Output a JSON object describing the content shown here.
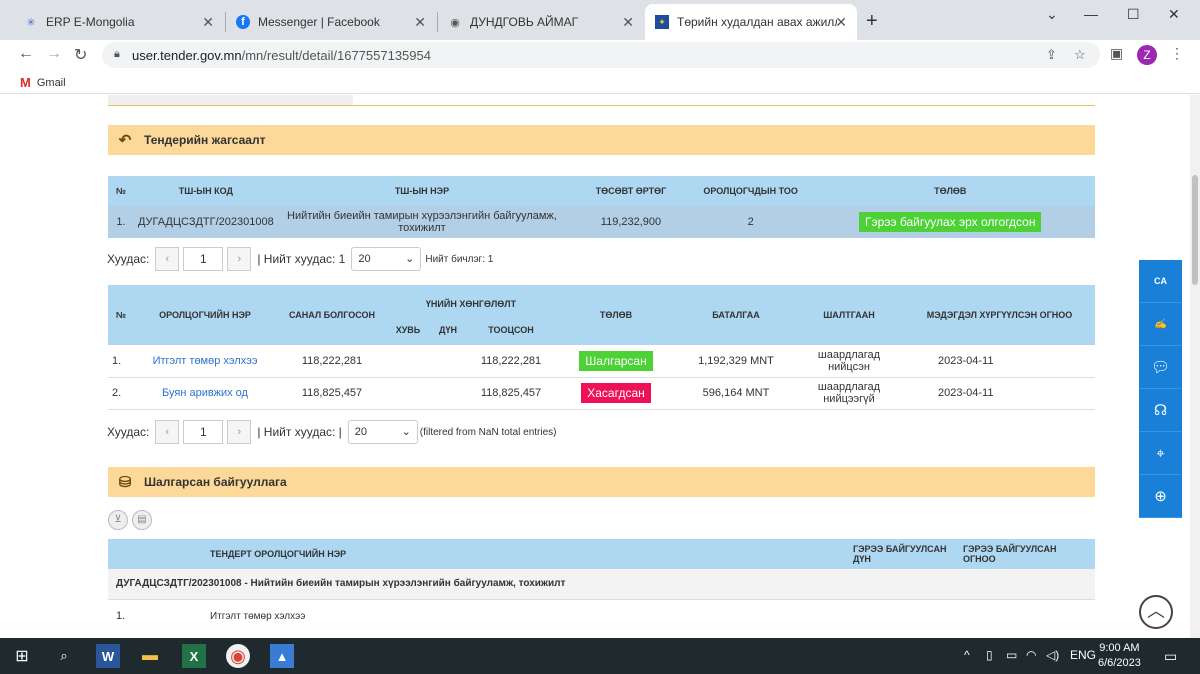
{
  "browser": {
    "tabs": [
      {
        "label": "ERP E-Mongolia",
        "icon": "erp-icon"
      },
      {
        "label": "Messenger | Facebook",
        "icon": "facebook-icon"
      },
      {
        "label": "ДУНДГОВЬ АЙМАГ",
        "icon": "globe-icon"
      },
      {
        "label": "Төрийн худалдан авах ажиллага",
        "icon": "emblem-icon"
      }
    ],
    "url_host": "user.tender.gov.mn",
    "url_path": "/mn/result/detail/1677557135954",
    "profile_initial": "Z",
    "bookmark": "Gmail"
  },
  "section1": {
    "title": "Тендерийн жагсаалт",
    "headers": [
      "№",
      "ТШ-ЫН КОД",
      "ТШ-ЫН НЭР",
      "ТӨСӨВТ ӨРТӨГ",
      "ОРОЛЦОГЧДЫН ТОО",
      "ТӨЛӨВ"
    ],
    "rows": [
      {
        "no": "1.",
        "code": "ДУГАДЦСЗДТГ/202301008",
        "name": "Нийтийн биеийн тамирын хүрээлэнгийн байгууламж, тохижилт",
        "budget": "119,232,900",
        "count": "2",
        "status": "Гэрээ байгуулах эрх олгогдсон"
      }
    ]
  },
  "pager1": {
    "label": "Хуудас:",
    "page": "1",
    "total": "| Нийт хуудас: 1",
    "per_page": "20",
    "records": "Нийт бичлэг: 1"
  },
  "section2": {
    "headers": {
      "no": "№",
      "name": "ОРОЛЦОГЧИЙН НЭР",
      "offer": "САНАЛ БОЛГОСОН",
      "group": "ҮНИЙН ХӨНГӨЛӨЛТ",
      "percent": "ХУВЬ",
      "amount": "ДҮН",
      "calc": "ТООЦСОН",
      "status": "ТӨЛӨВ",
      "guarantee": "БАТАЛГАА",
      "reason": "ШАЛТГААН",
      "date": "МЭДЭГДЭЛ ХҮРГҮҮЛСЭН ОГНОО"
    },
    "rows": [
      {
        "no": "1.",
        "name": "Итгэлт төмөр хэлхээ",
        "offer": "118,222,281",
        "percent": "",
        "amount": "",
        "calc": "118,222,281",
        "status": "Шалгарсан",
        "guarantee": "1,192,329 MNT",
        "reason": "шаардлагад нийцсэн",
        "date": "2023-04-11"
      },
      {
        "no": "2.",
        "name": "Буян аривжих од",
        "offer": "118,825,457",
        "percent": "",
        "amount": "",
        "calc": "118,825,457",
        "status": "Хасагдсан",
        "guarantee": "596,164 MNT",
        "reason": "шаардлагад нийцээгүй",
        "date": "2023-04-11"
      }
    ]
  },
  "pager2": {
    "label": "Хуудас:",
    "page": "1",
    "total": "| Нийт хуудас: |",
    "per_page": "20",
    "records": "(filtered from NaN total entries)"
  },
  "section3": {
    "title": "Шалгарсан байгууллага",
    "headers": [
      "ТЕНДЕРТ ОРОЛЦОГЧИЙН НЭР",
      "ГЭРЭЭ БАЙГУУЛСАН ДҮН",
      "ГЭРЭЭ БАЙГУУЛСАН ОГНОО"
    ],
    "group_row": "ДУГАДЦСЗДТГ/202301008 - Нийтийн биеийн тамирын хүрээлэнгийн байгууламж, тохижилт",
    "rows": [
      {
        "no": "1.",
        "name": "Итгэлт төмөр хэлхээ"
      }
    ]
  },
  "taskbar": {
    "lang": "ENG",
    "time": "9:00 AM",
    "date": "6/6/2023"
  },
  "colors": {
    "section_header": "#fcd899",
    "table_header": "#aed7f2",
    "status_green": "#4cd137",
    "status_red": "#ee1158",
    "side_panel": "#1a7fd6"
  }
}
